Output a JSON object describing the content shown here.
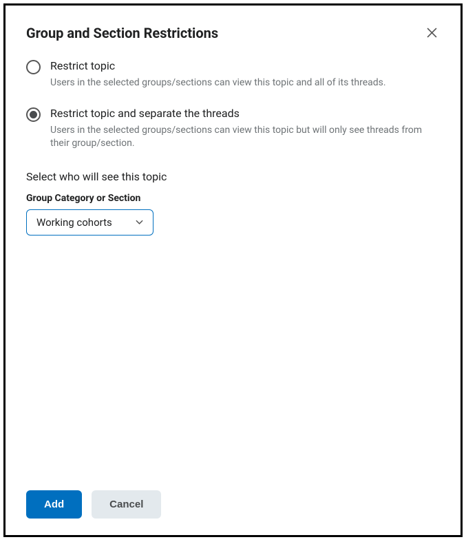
{
  "header": {
    "title": "Group and Section Restrictions"
  },
  "options": {
    "restrict_topic": {
      "label": "Restrict topic",
      "description": "Users in the selected groups/sections can view this topic and all of its threads.",
      "selected": false
    },
    "restrict_separate": {
      "label": "Restrict topic and separate the threads",
      "description": "Users in the selected groups/sections can view this topic but will only see threads from their group/section.",
      "selected": true
    }
  },
  "selector": {
    "prompt": "Select who will see this topic",
    "field_label": "Group Category or Section",
    "selected_value": "Working cohorts"
  },
  "footer": {
    "add_label": "Add",
    "cancel_label": "Cancel"
  }
}
